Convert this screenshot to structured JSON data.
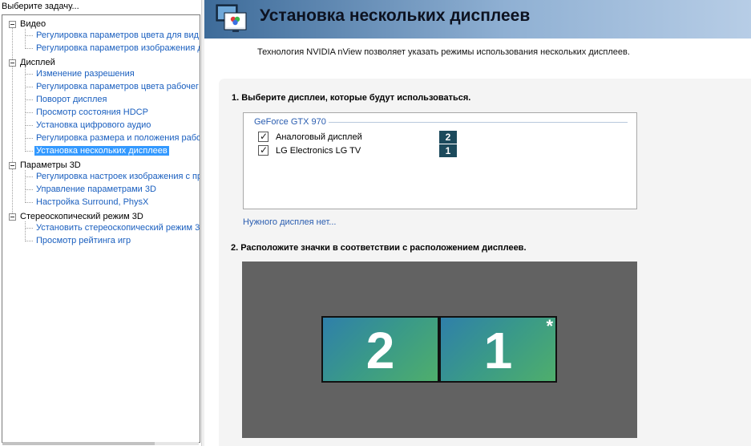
{
  "sidebar": {
    "header": "Выберите задачу...",
    "categories": [
      {
        "label": "Видео",
        "items": [
          "Регулировка параметров цвета для вид",
          "Регулировка параметров изображения д"
        ]
      },
      {
        "label": "Дисплей",
        "items": [
          "Изменение разрешения",
          "Регулировка параметров цвета рабочег",
          "Поворот дисплея",
          "Просмотр состояния HDCP",
          "Установка цифрового аудио",
          "Регулировка размера и положения рабо",
          "Установка нескольких дисплеев"
        ]
      },
      {
        "label": "Параметры 3D",
        "items": [
          "Регулировка настроек изображения с пр",
          "Управление параметрами 3D",
          "Настройка Surround, PhysX"
        ]
      },
      {
        "label": "Стереоскопический режим 3D",
        "items": [
          "Установить стереоскопический режим 3",
          "Просмотр рейтинга игр"
        ]
      }
    ],
    "selected_item": "Установка нескольких дисплеев"
  },
  "page": {
    "title": "Установка нескольких дисплеев",
    "description": "Технология NVIDIA nView позволяет указать режимы использования нескольких дисплеев."
  },
  "step1": {
    "heading": "1. Выберите дисплеи, которые будут использоваться.",
    "gpu_name": "GeForce GTX 970",
    "displays": [
      {
        "name": "Аналоговый дисплей",
        "checked": true,
        "number": "2"
      },
      {
        "name": "LG Electronics LG TV",
        "checked": true,
        "number": "1"
      }
    ],
    "missing_display_link": "Нужного дисплея нет..."
  },
  "step2": {
    "heading": "2. Расположите значки в соответствии с расположением дисплеев.",
    "monitors": [
      {
        "number": "2",
        "primary": false
      },
      {
        "number": "1",
        "primary": true,
        "primary_mark": "*"
      }
    ]
  },
  "colors": {
    "banner_start": "#3d6b99",
    "banner_end": "#b7cde6",
    "link": "#1a5fbf",
    "selection": "#3399ff",
    "badge": "#1c4a5c",
    "arrange_background": "#626262"
  },
  "icons": {
    "banner": "multiple-displays-icon",
    "tree_expander": "tree-collapse-icon",
    "checkbox": "checkmark-icon"
  }
}
